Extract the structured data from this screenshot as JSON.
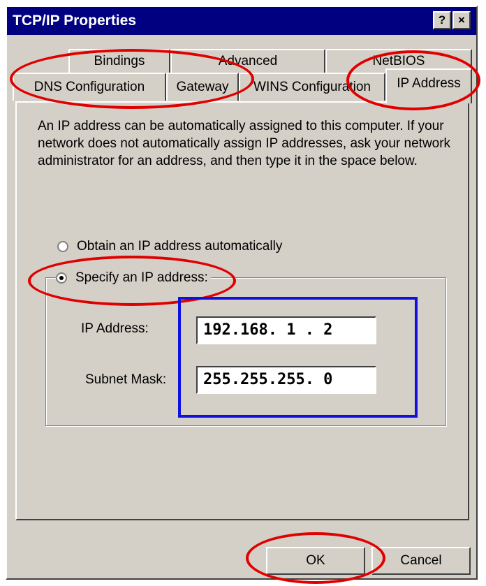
{
  "window": {
    "title": "TCP/IP Properties",
    "help_button": "?",
    "close_button": "×"
  },
  "tabs": {
    "back_row": [
      "Bindings",
      "Advanced",
      "NetBIOS"
    ],
    "front_row": [
      "DNS Configuration",
      "Gateway",
      "WINS Configuration",
      "IP Address"
    ],
    "active": "IP Address"
  },
  "description": "An IP address can be automatically assigned to this computer. If your network does not automatically assign IP addresses, ask your network administrator for an address, and then type it in the space below.",
  "options": {
    "auto_label": "Obtain an IP address automatically",
    "specify_label": "Specify an IP address:",
    "selected": "specify"
  },
  "fields": {
    "ip_address_label": "IP Address:",
    "ip_address_value": "192.168. 1 . 2",
    "subnet_mask_label": "Subnet Mask:",
    "subnet_mask_value": "255.255.255. 0"
  },
  "buttons": {
    "ok": "OK",
    "cancel": "Cancel"
  },
  "colors": {
    "title_bar": "#000080",
    "dialog_face": "#d4d0c8",
    "highlight_ellipse": "#e00000",
    "highlight_box": "#1010e0"
  }
}
